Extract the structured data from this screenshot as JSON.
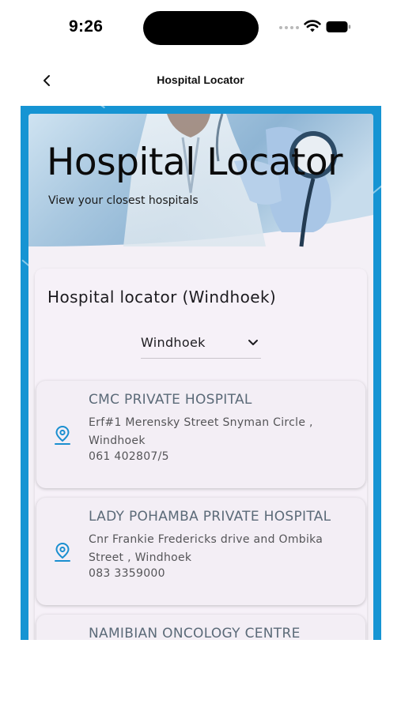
{
  "status_bar": {
    "time": "9:26"
  },
  "nav": {
    "title": "Hospital Locator"
  },
  "hero": {
    "title": "Hospital Locator",
    "subtitle": "View your closest hospitals"
  },
  "section": {
    "title": "Hospital locator (Windhoek)",
    "city_select": {
      "selected": "Windhoek"
    }
  },
  "hospitals": [
    {
      "name": "CMC PRIVATE HOSPITAL",
      "address": "Erf#1 Merensky Street Snyman Circle , Windhoek",
      "phone": "061 402807/5"
    },
    {
      "name": "LADY POHAMBA PRIVATE HOSPITAL",
      "address": "Cnr Frankie Fredericks drive and Ombika Street , Windhoek",
      "phone": "083 3359000"
    },
    {
      "name": "NAMIBIAN ONCOLOGY CENTRE",
      "address": "",
      "phone": ""
    }
  ],
  "icons": {
    "back": "chevron-left-icon",
    "dropdown": "chevron-down-icon",
    "location": "location-pin-icon"
  },
  "colors": {
    "frame_blue": "#1694d3",
    "pin_blue": "#1a8fd0",
    "card_title": "#5b6a78"
  }
}
